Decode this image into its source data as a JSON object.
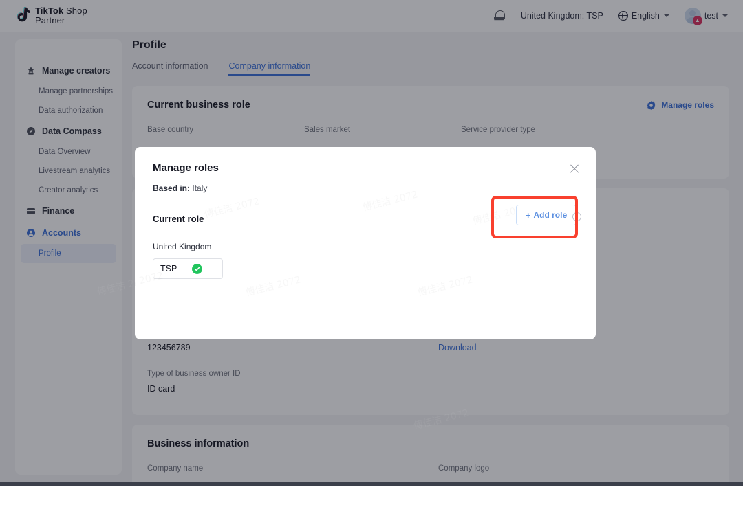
{
  "header": {
    "brand_bold": "TikTok",
    "brand_light": " Shop",
    "brand_line2": "Partner",
    "notification_icon": "bell-icon",
    "region_role": "United Kingdom: TSP",
    "language": "English",
    "globe_icon": "globe-icon",
    "user_name": "test",
    "avatar_icon": "avatar-icon"
  },
  "sidebar": {
    "items": [
      {
        "label": "Manage creators",
        "icon": "star-badge-icon",
        "level": "top",
        "state": "default"
      },
      {
        "label": "Manage partnerships",
        "icon": "",
        "level": "sub",
        "state": "default"
      },
      {
        "label": "Data authorization",
        "icon": "",
        "level": "sub",
        "state": "default"
      },
      {
        "label": "Data Compass",
        "icon": "compass-icon",
        "level": "top",
        "state": "default"
      },
      {
        "label": "Data Overview",
        "icon": "",
        "level": "sub",
        "state": "default"
      },
      {
        "label": "Livestream analytics",
        "icon": "",
        "level": "sub",
        "state": "default"
      },
      {
        "label": "Creator analytics",
        "icon": "",
        "level": "sub",
        "state": "default"
      },
      {
        "label": "Finance",
        "icon": "wallet-icon",
        "level": "top",
        "state": "default"
      },
      {
        "label": "Accounts",
        "icon": "user-circle-icon",
        "level": "top",
        "state": "active"
      },
      {
        "label": "Profile",
        "icon": "",
        "level": "sub",
        "state": "selected"
      }
    ]
  },
  "main": {
    "page_title": "Profile",
    "tabs": [
      {
        "label": "Account information",
        "active": false
      },
      {
        "label": "Company information",
        "active": true
      }
    ],
    "business_role_card": {
      "title": "Current business role",
      "manage_roles_label": "Manage roles",
      "gear_icon": "gear-icon",
      "columns": [
        {
          "label": "Base country",
          "value": ""
        },
        {
          "label": "Sales market",
          "value": ""
        },
        {
          "label": "Service provider type",
          "value": ""
        }
      ]
    },
    "id_card": {
      "business_owner_id_value": "123456789",
      "download_label": "Download",
      "type_label": "Type of business owner ID",
      "type_value": "ID card"
    },
    "business_info_card": {
      "title": "Business information",
      "company_name_label": "Company name",
      "company_logo_label": "Company logo"
    }
  },
  "modal": {
    "title": "Manage roles",
    "close_icon": "close-icon",
    "based_in_label": "Based in:",
    "based_in_value": "Italy",
    "current_role_label": "Current role",
    "add_role_label": "Add role",
    "add_role_plus_icon": "plus-icon",
    "role_country": "United Kingdom",
    "role_chip_label": "TSP",
    "role_chip_status_icon": "check-circle-icon"
  },
  "annotation": {
    "highlight_color": "#f9402e",
    "highlight_target": "add-role-button"
  },
  "watermark": {
    "text": "傅佳洁 2072"
  },
  "colors": {
    "accent": "#3a6fd8",
    "success": "#21c55d",
    "highlight": "#f9402e",
    "overlay": "rgba(22,24,35,0.42)"
  }
}
